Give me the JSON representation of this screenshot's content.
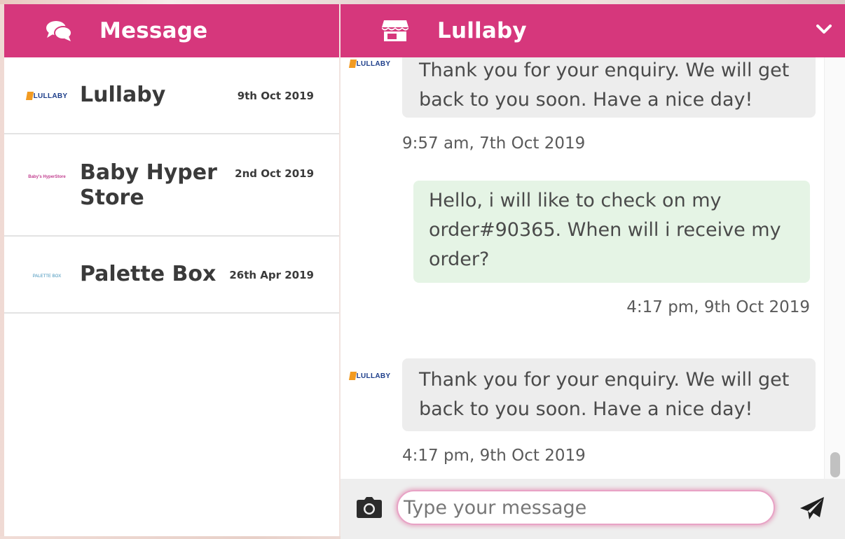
{
  "colors": {
    "brand_pink": "#d6377c",
    "incoming_bubble": "#ededed",
    "outgoing_bubble": "#e5f4e5"
  },
  "sidebar": {
    "title": "Message",
    "icon": "chat-bubbles-icon",
    "conversations": [
      {
        "name": "Lullaby",
        "date": "9th Oct 2019",
        "logo_text": "LULLABY"
      },
      {
        "name": "Baby Hyper Store",
        "date": "2nd Oct 2019",
        "logo_text": "Baby's HyperStore"
      },
      {
        "name": "Palette Box",
        "date": "26th Apr 2019",
        "logo_text": "PALETTE BOX"
      }
    ]
  },
  "chat": {
    "title": "Lullaby",
    "icon": "store-icon",
    "collapse_icon": "chevron-down-icon",
    "avatar_text": "LULLABY",
    "messages": [
      {
        "direction": "in",
        "text": "Thank you for your enquiry. We will get back to you soon. Have a nice day!",
        "time": "9:57 am, 7th Oct 2019"
      },
      {
        "direction": "out",
        "text": "Hello, i will like to check on my order#90365. When will i receive my order?",
        "time": "4:17 pm, 9th Oct 2019"
      },
      {
        "direction": "in",
        "text": "Thank you for your enquiry. We will get back to you soon. Have a nice day!",
        "time": "4:17 pm, 9th Oct 2019"
      }
    ]
  },
  "composer": {
    "placeholder": "Type your message",
    "camera_icon": "camera-icon",
    "send_icon": "send-icon"
  }
}
